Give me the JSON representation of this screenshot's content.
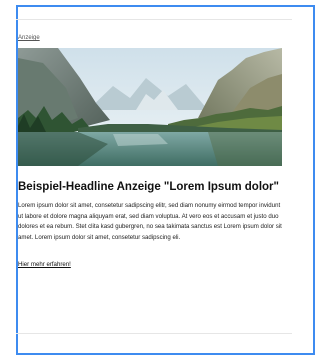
{
  "ad": {
    "label": "Anzeige",
    "image_alt": "Bergsee mit Bergen und Wald",
    "headline": "Beispiel-Headline Anzeige \"Lorem Ipsum dolor\"",
    "body": "Lorem ipsum dolor sit amet, consetetur sadipscing elitr, sed diam nonumy eirmod tempor invidunt ut labore et dolore magna aliquyam erat, sed diam voluptua. At vero eos et accusam et justo duo dolores et ea rebum. Stet clita kasd gubergren, no sea takimata sanctus est Lorem ipsum dolor sit amet. Lorem ipsum dolor sit amet, consetetur sadipscing eli.",
    "cta": "Hier mehr erfahren!"
  },
  "colors": {
    "frame_border": "#3d8bf0",
    "divider": "#e6e6e6"
  }
}
